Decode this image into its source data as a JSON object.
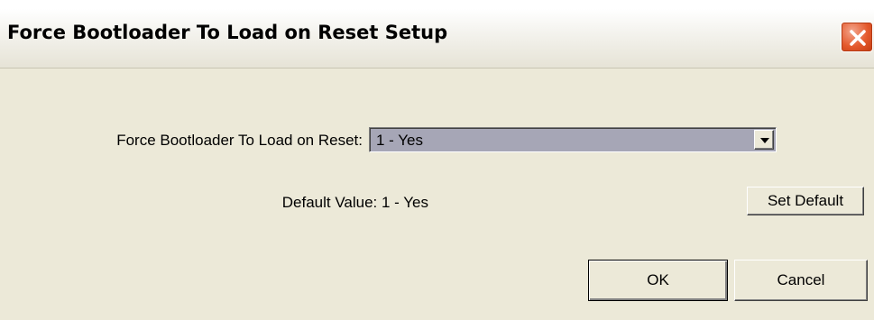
{
  "window": {
    "title": "Force Bootloader To Load on Reset Setup",
    "close_icon": "close-icon",
    "accent_color": "#e4592c"
  },
  "form": {
    "field_label": "Force Bootloader To Load on Reset:",
    "selected_value": "1 - Yes",
    "dropdown_icon": "chevron-down-icon",
    "default_text": "Default Value: 1 - Yes"
  },
  "buttons": {
    "set_default": "Set Default",
    "ok": "OK",
    "cancel": "Cancel"
  }
}
